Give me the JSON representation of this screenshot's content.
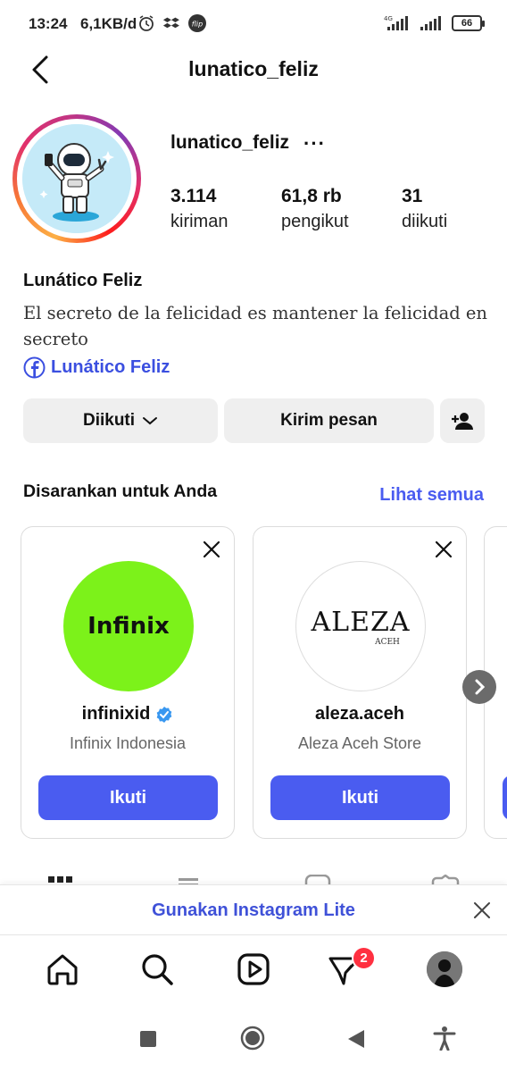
{
  "status": {
    "time": "13:24",
    "net_speed": "6,1KB/d",
    "battery": "66",
    "net_type": "4G"
  },
  "header": {
    "title": "lunatico_feliz"
  },
  "profile": {
    "username": "lunatico_feliz",
    "more": "···",
    "stats": [
      {
        "value": "3.114",
        "label": "kiriman"
      },
      {
        "value": "61,8 rb",
        "label": "pengikut"
      },
      {
        "value": "31",
        "label": "diikuti"
      }
    ],
    "display_name": "Lunático Feliz",
    "bio": "El secreto de la felicidad es mantener la felicidad en secreto",
    "link_label": "Lunático Feliz"
  },
  "actions": {
    "following": "Diikuti",
    "message": "Kirim pesan"
  },
  "suggestions": {
    "title": "Disarankan untuk Anda",
    "see_all": "Lihat semua",
    "cards": [
      {
        "username": "infinixid",
        "subtitle": "Infinix Indonesia",
        "follow": "Ikuti",
        "logo_text": "Infinix",
        "verified": true,
        "color": "#7cf21a"
      },
      {
        "username": "aleza.aceh",
        "subtitle": "Aleza Aceh Store",
        "follow": "Ikuti",
        "logo_text": "ALEZA",
        "logo_sub": "ACEH",
        "verified": false
      }
    ]
  },
  "banner": {
    "text": "Gunakan Instagram Lite"
  },
  "nav": {
    "activity_badge": "2"
  },
  "colors": {
    "accent": "#4a5cf0",
    "link": "#3b4fe0",
    "badge": "#ff3040"
  }
}
